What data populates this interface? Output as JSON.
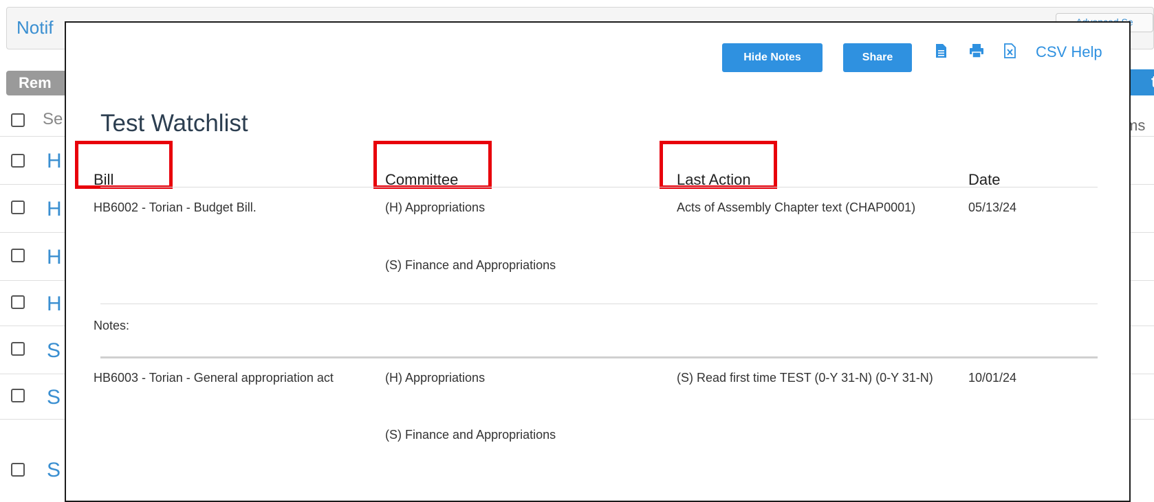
{
  "background": {
    "header_title": "Notif",
    "advanced_label": "Advanced Se",
    "remove_button": "Rem",
    "right_button": "t",
    "right_text": "ms",
    "select_label": "Se",
    "rows": [
      {
        "letter": "H"
      },
      {
        "letter": "H"
      },
      {
        "letter": "H"
      },
      {
        "letter": "H"
      },
      {
        "letter": "S"
      },
      {
        "letter": "S"
      },
      {
        "letter": "S"
      }
    ]
  },
  "modal": {
    "toolbar": {
      "hide_notes": "Hide Notes",
      "share": "Share",
      "icons": [
        "document-icon",
        "print-icon",
        "excel-icon"
      ],
      "csv_help": "CSV Help"
    },
    "title": "Test Watchlist",
    "columns": [
      "Bill",
      "Committee",
      "Last Action",
      "Date"
    ],
    "rows": [
      {
        "bill": "HB6002 - Torian - Budget Bill.",
        "committees": [
          "(H) Appropriations",
          "(S) Finance and Appropriations"
        ],
        "last_action": "Acts of Assembly Chapter text (CHAP0001)",
        "date": "05/13/24",
        "notes": "Notes:"
      },
      {
        "bill": "HB6003 - Torian - General appropriation act",
        "committees": [
          "(H) Appropriations",
          "(S) Finance and Appropriations"
        ],
        "last_action": "(S) Read first time TEST (0-Y 31-N) (0-Y 31-N)",
        "date": "10/01/24"
      }
    ]
  },
  "colors": {
    "accent": "#2f91e0",
    "highlight": "#e8000b",
    "title": "#2c3e50"
  }
}
